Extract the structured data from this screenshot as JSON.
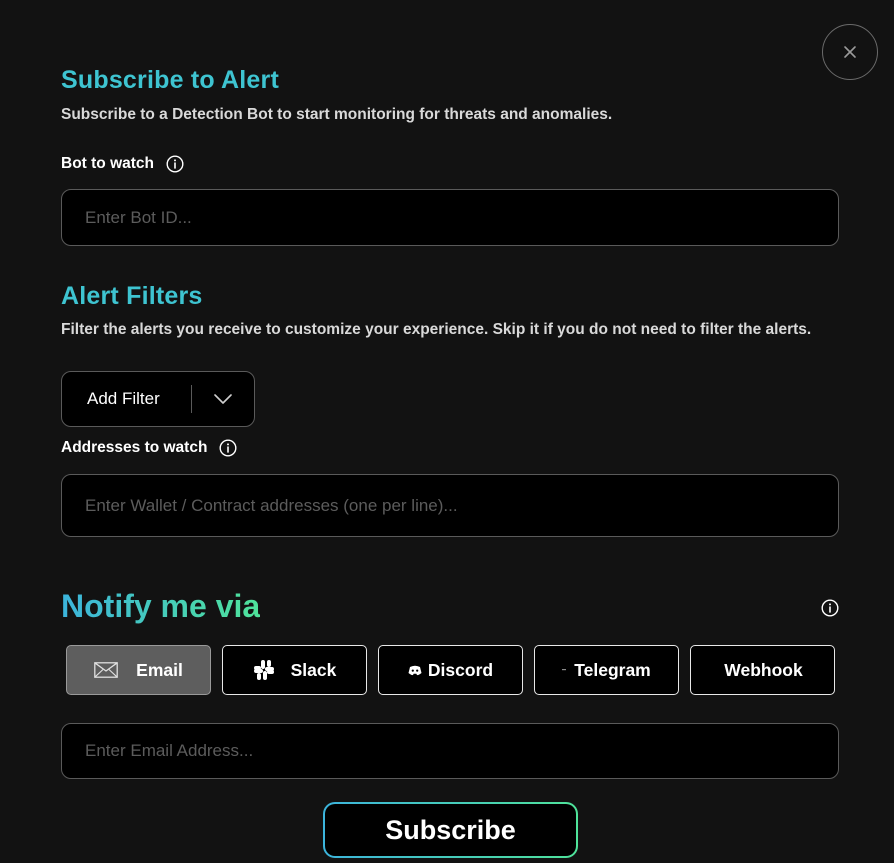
{
  "modal": {
    "title": "Subscribe to Alert",
    "subtitle": "Subscribe to a Detection Bot to start monitoring for threats and anomalies."
  },
  "bot": {
    "label": "Bot to watch",
    "placeholder": "Enter Bot ID..."
  },
  "filters": {
    "title": "Alert Filters",
    "subtitle": "Filter the alerts you receive to customize your experience. Skip it if you do not need to filter the alerts.",
    "add_filter_label": "Add Filter"
  },
  "addresses": {
    "label": "Addresses to watch",
    "placeholder": "Enter Wallet / Contract addresses (one per line)..."
  },
  "notify": {
    "title": "Notify me via",
    "channels": [
      {
        "label": "Email",
        "icon": "mail-icon",
        "selected": true
      },
      {
        "label": "Slack",
        "icon": "slack-icon",
        "selected": false
      },
      {
        "label": "Discord",
        "icon": "discord-icon",
        "selected": false
      },
      {
        "label": "Telegram",
        "icon": "telegram-icon",
        "selected": false
      },
      {
        "label": "Webhook",
        "icon": "webhook-icon",
        "selected": false
      }
    ],
    "email_placeholder": "Enter Email Address..."
  },
  "subscribe_label": "Subscribe",
  "colors": {
    "background": "#121212",
    "accent_teal": "#3ec4d1",
    "gradient_start": "#3cb4dc",
    "gradient_end": "#4fe39a",
    "selected_channel": "#5e5e5e"
  }
}
